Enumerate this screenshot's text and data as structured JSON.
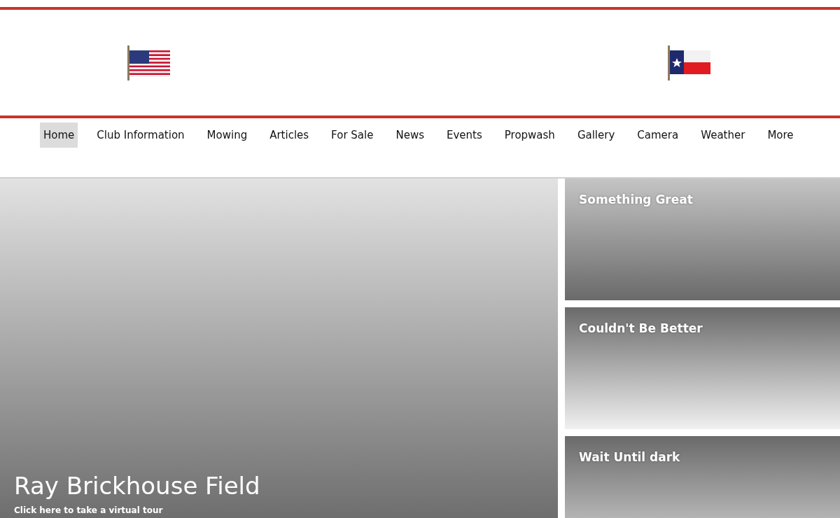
{
  "nav": [
    {
      "label": "Home",
      "selected": true
    },
    {
      "label": "Club Information",
      "selected": false
    },
    {
      "label": "Mowing",
      "selected": false
    },
    {
      "label": "Articles",
      "selected": false
    },
    {
      "label": "For Sale",
      "selected": false
    },
    {
      "label": "News",
      "selected": false
    },
    {
      "label": "Events",
      "selected": false
    },
    {
      "label": "Propwash",
      "selected": false
    },
    {
      "label": "Gallery",
      "selected": false
    },
    {
      "label": "Camera",
      "selected": false
    },
    {
      "label": "Weather",
      "selected": false
    },
    {
      "label": "More",
      "selected": false
    }
  ],
  "hero": {
    "title": "Ray Brickhouse Field",
    "link": "Click here to take a virtual tour"
  },
  "cards": [
    {
      "title": "Something Great",
      "kind": "fade-down"
    },
    {
      "title": "Couldn't Be Better",
      "kind": "fade-up"
    },
    {
      "title": "Wait Until dark",
      "kind": "fade-down-dark"
    }
  ]
}
